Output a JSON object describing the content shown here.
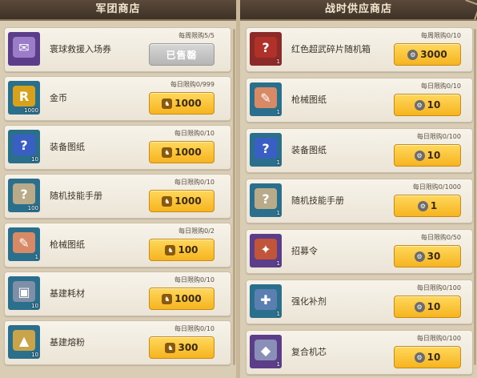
{
  "left": {
    "title": "军团商店",
    "items": [
      {
        "name": "寰球救援入场券",
        "limit": "每周限购5/5",
        "price": "",
        "sold": true,
        "sold_label": "已售罄",
        "icon": "ticket-icon",
        "icon_bg": "#5b3d8a",
        "count": ""
      },
      {
        "name": "金币",
        "limit": "每日限购0/999",
        "price": "1000",
        "sold": false,
        "sold_label": "",
        "icon": "gold-coin-icon",
        "icon_bg": "#2a6f8c",
        "count": "1000"
      },
      {
        "name": "装备图纸",
        "limit": "每日限购0/10",
        "price": "1000",
        "sold": false,
        "sold_label": "",
        "icon": "mystery-blueprint-icon",
        "icon_bg": "#2a6f8c",
        "count": "10"
      },
      {
        "name": "随机技能手册",
        "limit": "每日限购0/10",
        "price": "1000",
        "sold": false,
        "sold_label": "",
        "icon": "skill-manual-icon",
        "icon_bg": "#2a6f8c",
        "count": "100"
      },
      {
        "name": "枪械图纸",
        "limit": "每日限购0/2",
        "price": "100",
        "sold": false,
        "sold_label": "",
        "icon": "gun-blueprint-icon",
        "icon_bg": "#2a6f8c",
        "count": "1"
      },
      {
        "name": "基建耗材",
        "limit": "每日限购0/10",
        "price": "1000",
        "sold": false,
        "sold_label": "",
        "icon": "building-material-icon",
        "icon_bg": "#2a6f8c",
        "count": "10"
      },
      {
        "name": "基建熔粉",
        "limit": "每日限购0/10",
        "price": "300",
        "sold": false,
        "sold_label": "",
        "icon": "building-powder-icon",
        "icon_bg": "#2a6f8c",
        "count": "10"
      }
    ]
  },
  "right": {
    "title": "战时供应商店",
    "items": [
      {
        "name": "红色超武碎片随机箱",
        "limit": "每周限购0/10",
        "price": "3000",
        "icon": "red-crate-icon",
        "icon_bg": "#8c2a2a",
        "count": "1"
      },
      {
        "name": "枪械图纸",
        "limit": "每日限购0/10",
        "price": "10",
        "icon": "gun-blueprint-icon",
        "icon_bg": "#2a6f8c",
        "count": "1"
      },
      {
        "name": "装备图纸",
        "limit": "每日限购0/100",
        "price": "10",
        "icon": "mystery-blueprint-icon",
        "icon_bg": "#2a6f8c",
        "count": "1"
      },
      {
        "name": "随机技能手册",
        "limit": "每日限购0/1000",
        "price": "1",
        "icon": "skill-manual-icon",
        "icon_bg": "#2a6f8c",
        "count": "1"
      },
      {
        "name": "招募令",
        "limit": "每日限购0/50",
        "price": "30",
        "icon": "recruit-order-icon",
        "icon_bg": "#5b3d8a",
        "count": "1"
      },
      {
        "name": "强化补剂",
        "limit": "每日限购0/100",
        "price": "10",
        "icon": "syringe-icon",
        "icon_bg": "#2a6f8c",
        "count": "1"
      },
      {
        "name": "复合机芯",
        "limit": "每日限购0/100",
        "price": "10",
        "icon": "chip-icon",
        "icon_bg": "#5b3d8a",
        "count": "1"
      }
    ]
  },
  "colors": {
    "price_button": "#f6b420",
    "sold_button": "#b5b5b5",
    "header": "#3d3127"
  }
}
